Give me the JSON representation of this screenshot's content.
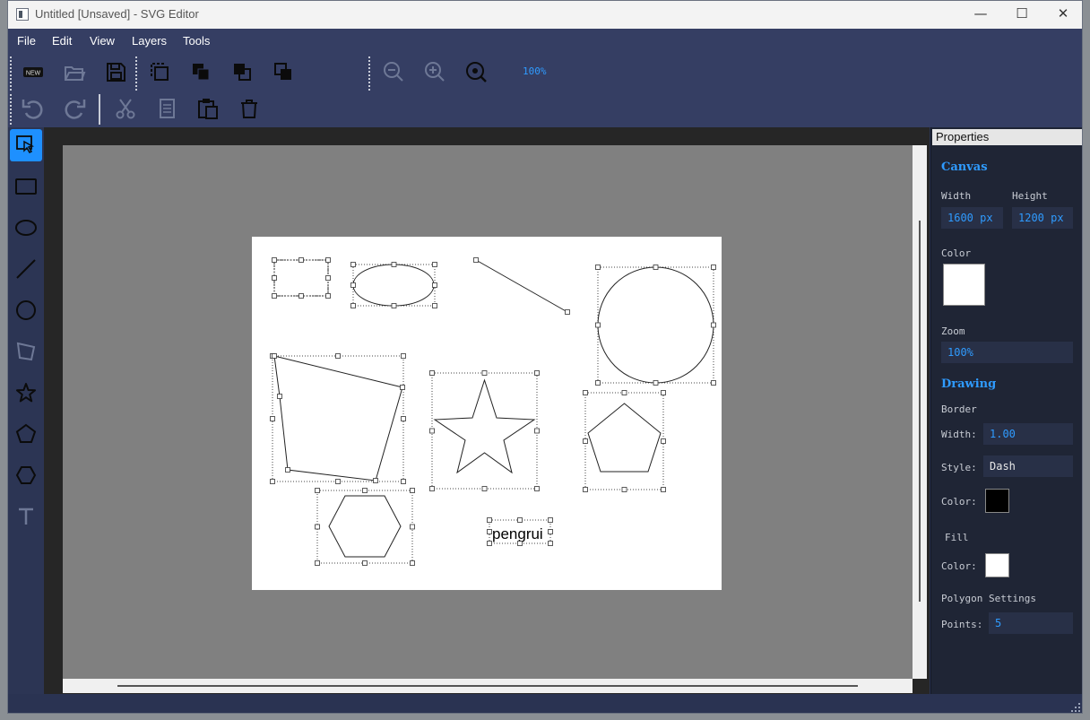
{
  "window": {
    "title": "Untitled [Unsaved] - SVG Editor"
  },
  "menu": [
    "File",
    "Edit",
    "View",
    "Layers",
    "Tools"
  ],
  "toolbar": {
    "zoom": "100%"
  },
  "icons": {
    "toolbar_row1": [
      "new-document-icon",
      "open-folder-icon",
      "save-icon",
      "duplicate-icon",
      "bring-forward-icon",
      "send-backward-icon",
      "group-icon",
      "zoom-out-icon",
      "zoom-in-icon",
      "zoom-fit-icon"
    ],
    "toolbar_row2": [
      "undo-icon",
      "redo-icon",
      "cut-icon",
      "copy-icon",
      "paste-icon",
      "delete-icon"
    ],
    "tools": [
      "select-tool-icon",
      "rectangle-tool-icon",
      "ellipse-tool-icon",
      "line-tool-icon",
      "circle-tool-icon",
      "polygon-tool-icon",
      "star-tool-icon",
      "pentagon-tool-icon",
      "hexagon-tool-icon",
      "text-tool-icon"
    ]
  },
  "canvas": {
    "text_object": "pengrui"
  },
  "properties": {
    "header": "Properties",
    "canvas_title": "Canvas",
    "width_label": "Width",
    "height_label": "Height",
    "width_value": "1600 px",
    "height_value": "1200 px",
    "color_label": "Color",
    "canvas_color": "#ffffff",
    "zoom_label": "Zoom",
    "zoom_value": "100%",
    "drawing_title": "Drawing",
    "border_label": "Border",
    "border_width_label": "Width:",
    "border_width_value": "1.00",
    "border_style_label": "Style:",
    "border_style_value": "Dash",
    "border_color_label": "Color:",
    "border_color": "#000000",
    "fill_label": "Fill",
    "fill_color_label": "Color:",
    "fill_color": "#ffffff",
    "polygon_label": "Polygon Settings",
    "points_label": "Points:",
    "points_value": "5"
  },
  "colors": {
    "accent": "#1e90ff",
    "panel": "#1f2535",
    "toolbar": "#353e63"
  }
}
